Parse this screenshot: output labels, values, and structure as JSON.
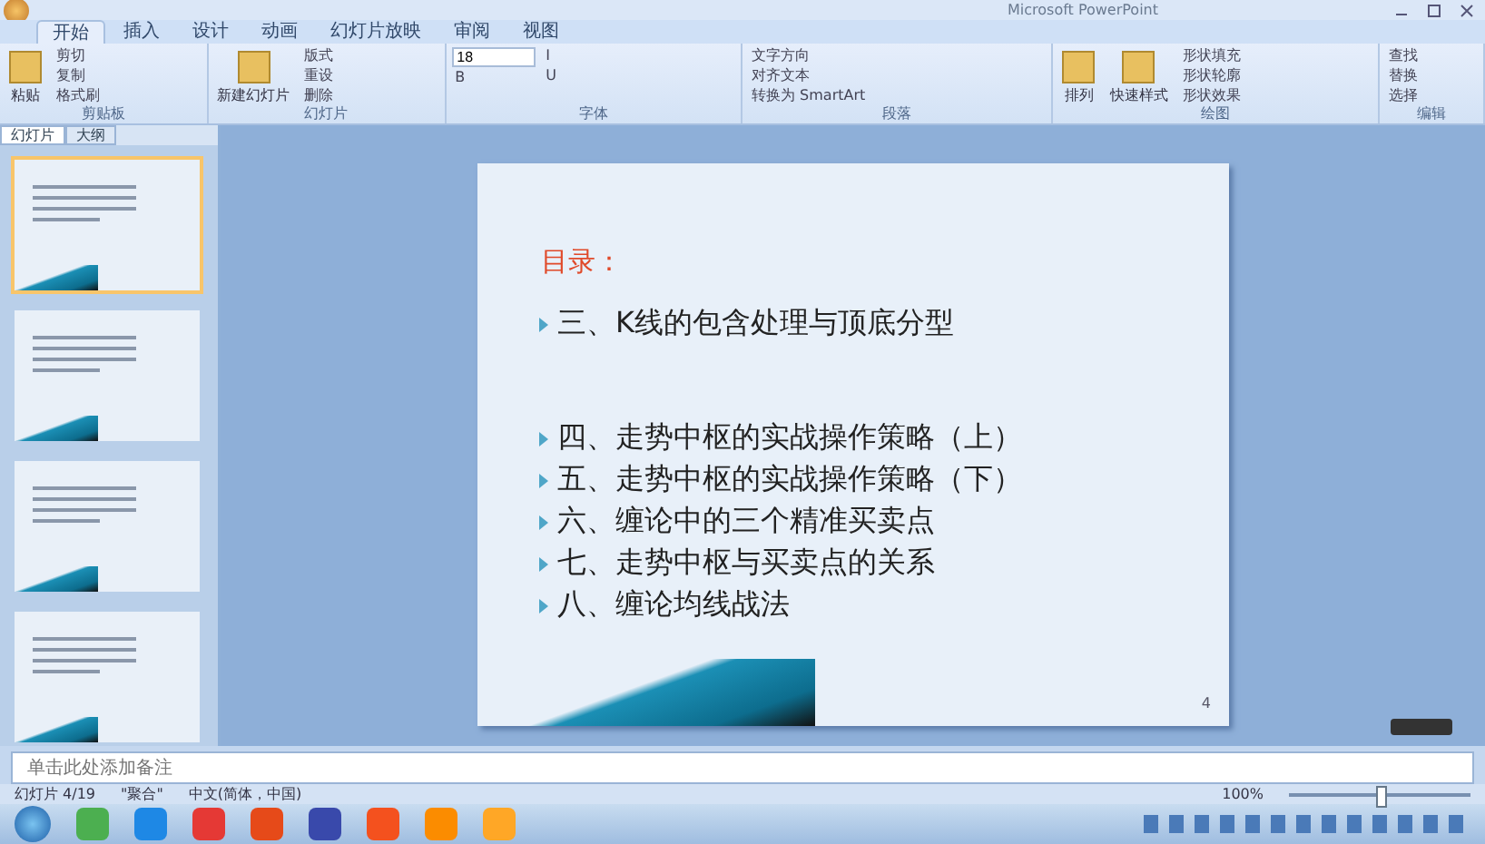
{
  "window": {
    "title": "Microsoft PowerPoint"
  },
  "ribbon_tabs": [
    {
      "label": "开始",
      "selected": true
    },
    {
      "label": "插入",
      "selected": false
    },
    {
      "label": "设计",
      "selected": false
    },
    {
      "label": "动画",
      "selected": false
    },
    {
      "label": "幻灯片放映",
      "selected": false
    },
    {
      "label": "审阅",
      "selected": false
    },
    {
      "label": "视图",
      "selected": false
    }
  ],
  "ribbon_groups": [
    {
      "label": "剪贴板",
      "buttons": [
        {
          "label": "粘贴",
          "kind": "large"
        },
        {
          "label": "剪切",
          "kind": "small"
        },
        {
          "label": "复制",
          "kind": "small"
        },
        {
          "label": "格式刷",
          "kind": "small"
        }
      ]
    },
    {
      "label": "幻灯片",
      "buttons": [
        {
          "label": "新建幻灯片",
          "kind": "large"
        },
        {
          "label": "版式",
          "kind": "small"
        },
        {
          "label": "重设",
          "kind": "small"
        },
        {
          "label": "删除",
          "kind": "small"
        }
      ]
    },
    {
      "label": "字体",
      "buttons": [
        {
          "label": "18",
          "kind": "field"
        },
        {
          "label": "B",
          "kind": "small"
        },
        {
          "label": "I",
          "kind": "small"
        },
        {
          "label": "U",
          "kind": "small"
        }
      ]
    },
    {
      "label": "段落",
      "buttons": [
        {
          "label": "文字方向",
          "kind": "small"
        },
        {
          "label": "对齐文本",
          "kind": "small"
        },
        {
          "label": "转换为 SmartArt",
          "kind": "small"
        }
      ]
    },
    {
      "label": "绘图",
      "buttons": [
        {
          "label": "排列",
          "kind": "large"
        },
        {
          "label": "快速样式",
          "kind": "large"
        },
        {
          "label": "形状填充",
          "kind": "small"
        },
        {
          "label": "形状轮廓",
          "kind": "small"
        },
        {
          "label": "形状效果",
          "kind": "small"
        }
      ]
    },
    {
      "label": "编辑",
      "buttons": [
        {
          "label": "查找",
          "kind": "small"
        },
        {
          "label": "替换",
          "kind": "small"
        },
        {
          "label": "选择",
          "kind": "small"
        }
      ]
    }
  ],
  "pane_tabs": [
    {
      "label": "幻灯片",
      "selected": true
    },
    {
      "label": "大纲",
      "selected": false
    }
  ],
  "thumbnails": [
    {
      "selected": true
    },
    {
      "selected": false
    },
    {
      "selected": false
    },
    {
      "selected": false
    }
  ],
  "slide": {
    "heading": "目录：",
    "items": [
      "三、K线的包含处理与顶底分型",
      "四、走势中枢的实战操作策略（上）",
      "五、走势中枢的实战操作策略（下）",
      "六、缠论中的三个精准买卖点",
      "七、走势中枢与买卖点的关系",
      "八、缠论均线战法"
    ],
    "page_number": "4"
  },
  "notes": {
    "placeholder": "单击此处添加备注"
  },
  "status_bar": {
    "slide_info": "幻灯片 4/19",
    "theme": "\"聚合\"",
    "language": "中文(简体，中国)",
    "zoom": "100%",
    "zoom_slider": {
      "level": 0.5
    }
  }
}
